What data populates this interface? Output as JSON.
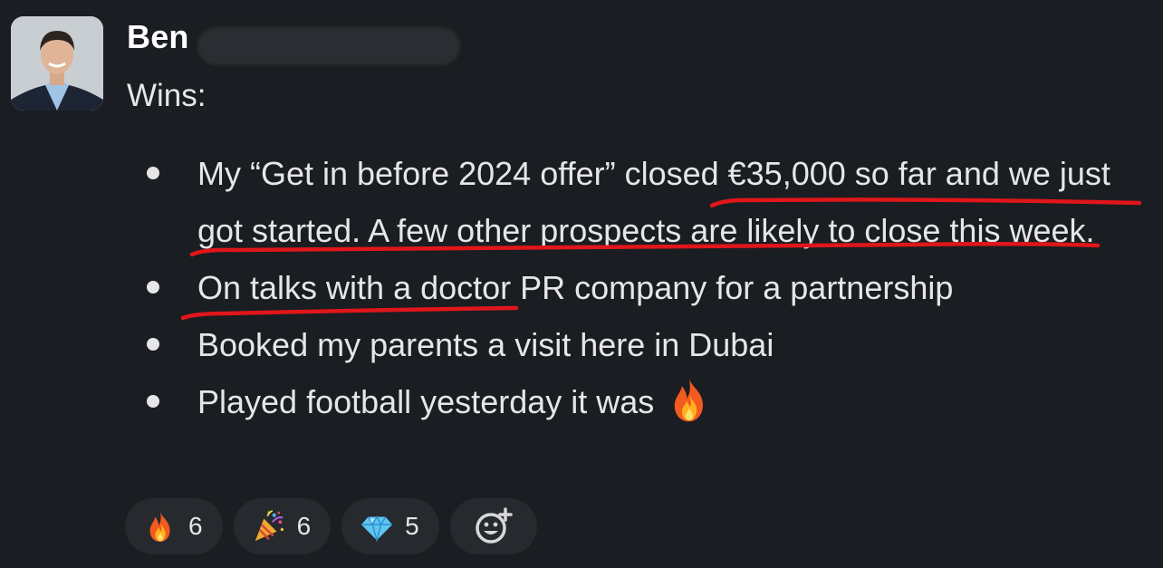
{
  "message": {
    "author": "Ben",
    "heading": "Wins:",
    "items": [
      "My “Get in before 2024 offer” closed €35,000 so far and we just got started. A few other prospects are likely to close this week.",
      "On talks with a doctor PR company for a partnership",
      "Booked my parents a visit here in Dubai",
      "Played football yesterday it was"
    ]
  },
  "reactions": [
    {
      "emoji": "fire-emoji",
      "count": "6"
    },
    {
      "emoji": "party-popper-emoji",
      "count": "6"
    },
    {
      "emoji": "gem-emoji",
      "count": "5"
    }
  ],
  "add_reaction_icon": "add-reaction-icon",
  "colors": {
    "background": "#1a1d21",
    "text": "#e6e6e6",
    "pill": "#26292d",
    "annotation": "#e0161b"
  }
}
